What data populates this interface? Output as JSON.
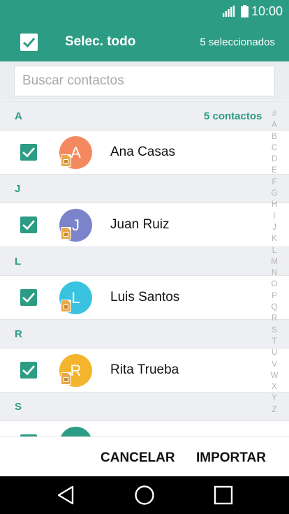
{
  "status": {
    "time": "10:00"
  },
  "header": {
    "select_all_label": "Selec. todo",
    "selected_count": "5 seleccionados"
  },
  "search": {
    "placeholder": "Buscar contactos"
  },
  "sections": [
    {
      "letter": "A",
      "count": "5 contactos"
    },
    {
      "letter": "J"
    },
    {
      "letter": "L"
    },
    {
      "letter": "R"
    },
    {
      "letter": "S"
    }
  ],
  "contacts": [
    {
      "initial": "A",
      "name": "Ana Casas",
      "color": "#f4895f"
    },
    {
      "initial": "J",
      "name": "Juan Ruiz",
      "color": "#7b84cb"
    },
    {
      "initial": "L",
      "name": "Luis Santos",
      "color": "#39c3e0"
    },
    {
      "initial": "R",
      "name": "Rita Trueba",
      "color": "#f4b42c"
    },
    {
      "initial": "",
      "name": "",
      "color": "#2d9c84"
    }
  ],
  "alphabet": [
    "#",
    "A",
    "B",
    "C",
    "D",
    "E",
    "F",
    "G",
    "H",
    "I",
    "J",
    "K",
    "L",
    "M",
    "N",
    "O",
    "P",
    "Q",
    "R",
    "S",
    "T",
    "U",
    "V",
    "W",
    "X",
    "Y",
    "Z"
  ],
  "actions": {
    "cancel": "CANCELAR",
    "import": "IMPORTAR"
  },
  "colors": {
    "accent": "#2d9c84",
    "section_bg": "#eeeff2"
  },
  "icons": [
    "signal-icon",
    "battery-icon",
    "checkbox-checked-icon",
    "sim-card-icon",
    "back-icon",
    "home-icon",
    "recents-icon"
  ]
}
